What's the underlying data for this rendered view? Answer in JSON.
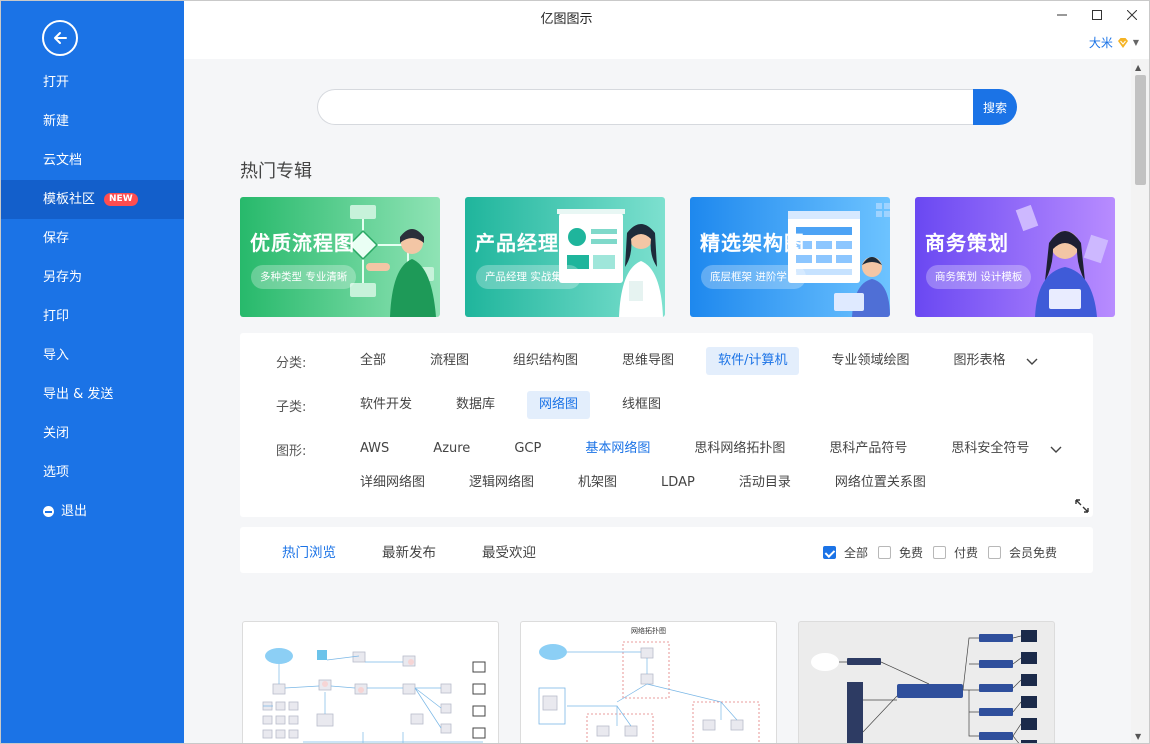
{
  "window": {
    "title": "亿图图示"
  },
  "user": {
    "name": "大米"
  },
  "sidebar": {
    "items": [
      {
        "label": "打开"
      },
      {
        "label": "新建"
      },
      {
        "label": "云文档"
      },
      {
        "label": "模板社区",
        "badge": "NEW",
        "active": true
      },
      {
        "label": "保存"
      },
      {
        "label": "另存为"
      },
      {
        "label": "打印"
      },
      {
        "label": "导入"
      },
      {
        "label": "导出 & 发送"
      },
      {
        "label": "关闭"
      },
      {
        "label": "选项"
      },
      {
        "label": "退出",
        "icon": "exit-icon"
      }
    ]
  },
  "search": {
    "placeholder": "",
    "button": "搜索"
  },
  "hot": {
    "title": "热门专辑",
    "banners": [
      {
        "title": "优质流程图",
        "subtitle": "多种类型 专业清晰",
        "color_from": "#27b96b",
        "color_to": "#8fe3b5"
      },
      {
        "title": "产品经理",
        "subtitle": "产品经理 实战集合",
        "color_from": "#1fb59c",
        "color_to": "#7de0cf"
      },
      {
        "title": "精选架构图",
        "subtitle": "底层框架 进阶学习",
        "color_from": "#1e88ee",
        "color_to": "#6dc3ff"
      },
      {
        "title": "商务策划",
        "subtitle": "商务策划 设计模板",
        "color_from": "#6a48f2",
        "color_to": "#b88cff"
      }
    ]
  },
  "filters": {
    "category": {
      "label": "分类:",
      "items": [
        "全部",
        "流程图",
        "组织结构图",
        "思维导图",
        "软件/计算机",
        "专业领域绘图",
        "图形表格"
      ],
      "selected": "软件/计算机"
    },
    "subcategory": {
      "label": "子类:",
      "items": [
        "软件开发",
        "数据库",
        "网络图",
        "线框图"
      ],
      "selected": "网络图"
    },
    "shape": {
      "label": "图形:",
      "row1": [
        "AWS",
        "Azure",
        "GCP",
        "基本网络图",
        "思科网络拓扑图",
        "思科产品符号",
        "思科安全符号"
      ],
      "row2": [
        "详细网络图",
        "逻辑网络图",
        "机架图",
        "LDAP",
        "活动目录",
        "网络位置关系图"
      ],
      "highlighted": "基本网络图"
    }
  },
  "sort_tabs": {
    "items": [
      "热门浏览",
      "最新发布",
      "最受欢迎"
    ],
    "active": "热门浏览"
  },
  "price_filters": [
    {
      "label": "全部",
      "checked": true
    },
    {
      "label": "免费",
      "checked": false
    },
    {
      "label": "付费",
      "checked": false
    },
    {
      "label": "会员免费",
      "checked": false
    }
  ],
  "templates": [
    {
      "title": ""
    },
    {
      "title": "网络拓扑图"
    },
    {
      "title": ""
    }
  ],
  "colors": {
    "accent": "#1b73e6",
    "sidebar": "#1b73e6",
    "sidebar_active": "#135fcb",
    "badge": "#ff4d4f"
  }
}
